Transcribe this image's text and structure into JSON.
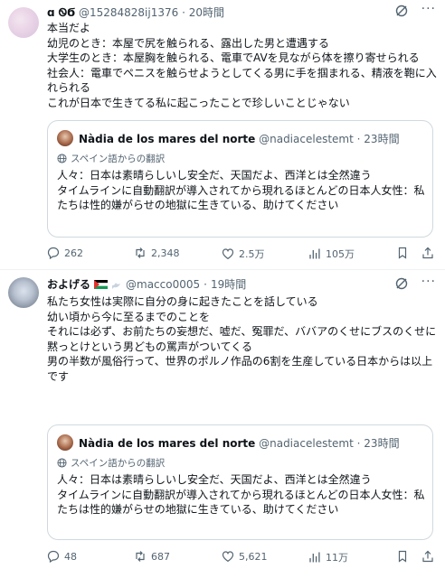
{
  "tweets": [
    {
      "handle": "@15284828ij1376",
      "time": "20時間",
      "body": [
        "本当だよ",
        "幼児のとき：本屋で尻を触られる、露出した男と遭遇する",
        "大学生のとき：本屋胸を触られる、電車でAVを見ながら体を擦り寄せられる",
        "社会人：電車でペニスを触らせようとしてくる男に手を掴まれる、精液を鞄に入れられる",
        "これが日本で生きてる私に起こったことで珍しいことじゃない"
      ],
      "quote": {
        "name": "Nàdia de los mares del norte",
        "handle": "@nadiacelestemt",
        "time": "23時間",
        "translation_label": "スペイン語からの翻訳",
        "text": [
          "人々：日本は素晴らしいし安全だ、天国だよ、西洋とは全然違う",
          "",
          "タイムラインに自動翻訳が導入されてから現れるほとんどの日本人女性：私たちは性的嫌がらせの地獄に生きている、助けてください"
        ]
      },
      "stats": {
        "replies": "262",
        "retweets": "2,348",
        "likes": "2.5万",
        "views": "105万"
      }
    },
    {
      "display_name": "およげる",
      "handle": "@macco0005",
      "time": "19時間",
      "body": [
        "私たち女性は実際に自分の身に起きたことを話している",
        "幼い頃から今に至るまでのことを",
        "",
        "それには必ず、お前たちの妄想だ、嘘だ、冤罪だ、ババアのくせにブスのくせに黙っとけという男どもの罵声がついてくる",
        "",
        "男の半数が風俗行って、世界のポルノ作品の6割を生産している日本からは以上です"
      ],
      "quote": {
        "name": "Nàdia de los mares del norte",
        "handle": "@nadiacelestemt",
        "time": "23時間",
        "translation_label": "スペイン語からの翻訳",
        "text": [
          "人々：日本は素晴らしいし安全だ、天国だよ、西洋とは全然違う",
          "",
          "タイムラインに自動翻訳が導入されてから現れるほとんどの日本人女性：私たちは性的嫌がらせの地獄に生きている、助けてください"
        ]
      },
      "stats": {
        "replies": "48",
        "retweets": "687",
        "likes": "5,621",
        "views": "11万"
      }
    }
  ],
  "sep": "·",
  "more_label": "···",
  "colors": {
    "text": "#0f1419",
    "muted": "#536471",
    "border": "#cfd9de",
    "flag_green": "#149954",
    "flag_red": "#e4312b"
  },
  "icons": [
    "grok-icon",
    "reply-icon",
    "retweet-icon",
    "like-icon",
    "views-icon",
    "bookmark-icon",
    "share-icon",
    "globe-icon",
    "palestine-flag-icon",
    "dove-icon"
  ]
}
